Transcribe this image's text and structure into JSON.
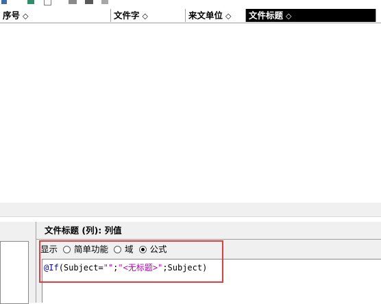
{
  "columns": [
    {
      "label": "序号",
      "sort": "◇"
    },
    {
      "label": "文件字",
      "sort": "◇"
    },
    {
      "label": "来文单位",
      "sort": "◇"
    },
    {
      "label": "文件标题",
      "sort": "◇"
    },
    {
      "label": "",
      "sort": ""
    }
  ],
  "panel": {
    "title": "文件标题 (列): 列值",
    "display_label": "显示",
    "options": [
      {
        "label": "简单功能",
        "selected": false
      },
      {
        "label": "域",
        "selected": false
      },
      {
        "label": "公式",
        "selected": true
      }
    ],
    "formula": {
      "keyword": "@If",
      "part1": "(Subject=",
      "str1": "\"\"",
      "sep1": ";",
      "str2": "\"<无标题>\"",
      "part2": ";Subject)"
    }
  },
  "colors": {
    "selected_header_bg": "#000000",
    "highlight_border": "#e43c3c",
    "keyword": "#0000c8",
    "string": "#c000c0"
  }
}
